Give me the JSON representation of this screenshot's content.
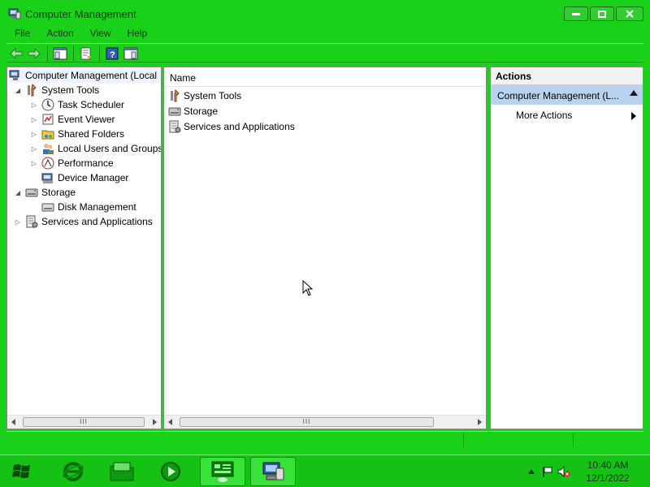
{
  "window": {
    "title": "Computer Management",
    "controls": {
      "minimize": "minimize",
      "maximize": "maximize",
      "close": "close"
    }
  },
  "menu": [
    "File",
    "Action",
    "View",
    "Help"
  ],
  "tree": {
    "root": "Computer Management (Local",
    "system_tools": "System Tools",
    "task_scheduler": "Task Scheduler",
    "event_viewer": "Event Viewer",
    "shared_folders": "Shared Folders",
    "local_users": "Local Users and Groups",
    "performance": "Performance",
    "device_manager": "Device Manager",
    "storage": "Storage",
    "disk_management": "Disk Management",
    "services": "Services and Applications"
  },
  "list": {
    "header_name": "Name",
    "items": [
      "System Tools",
      "Storage",
      "Services and Applications"
    ]
  },
  "actions": {
    "header": "Actions",
    "section": "Computer Management (L...",
    "more_actions": "More Actions"
  },
  "taskbar": {
    "time": "10:40 AM",
    "date": "12/1/2022"
  },
  "colors": {
    "chrome_green": "#19d119",
    "selection_blue": "#b9d3ee"
  }
}
